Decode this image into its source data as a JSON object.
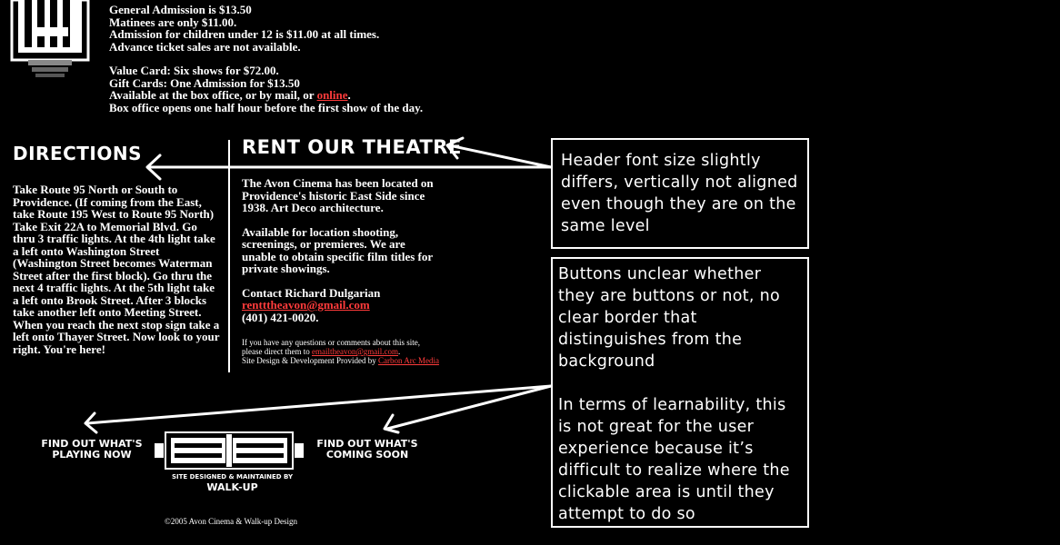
{
  "admission": {
    "lines": [
      "General Admission is $13.50",
      "Matinees are only $11.00.",
      "Admission for children under 12 is $11.00 at all times.",
      "Advance ticket sales are not available."
    ],
    "value_card": "Value Card: Six shows for $72.00.",
    "gift_cards": "Gift Cards: One Admission for $13.50",
    "available_prefix": "Available at the box office, or by mail, or ",
    "online_link": "online",
    "available_suffix": ".",
    "box_office": "Box office opens one half hour before the first show of the day."
  },
  "directions": {
    "heading": "Directions",
    "body": "Take Route 95 North or South to Providence. (If coming from the East, take Route 195 West to Route 95 North) Take Exit 22A to Memorial Blvd. Go thru 3 traffic lights. At the 4th light take a left onto Washington Street (Washington Street becomes Waterman Street after the first block). Go thru the next 4 traffic lights. At the 5th light take a left onto Brook Street. After 3 blocks take another left onto Meeting Street. When you reach the next stop sign take a left onto Thayer Street. Now look to your right. You're here!"
  },
  "rent": {
    "heading": "Rent Our Theatre",
    "p1": "The Avon Cinema has been located on Providence's historic East Side since 1938. Art Deco architecture.",
    "p2": "Available for location shooting, screenings, or premieres. We are unable to obtain specific film titles for private showings.",
    "contact": "Contact Richard Dulgarian",
    "email": "rentttheavon@gmail.com",
    "phone": "(401) 421-0020.",
    "small_1": "If you have any questions or comments about this site,",
    "small_2_prefix": "please direct them to ",
    "small_email": "emailtheavon@gmail.com",
    "small_2_suffix": ".",
    "small_3_prefix": "Site Design & Development Provided by ",
    "small_credit_link": "Carbon Arc Media"
  },
  "nav": {
    "playing_now_1": "Find out what's",
    "playing_now_2": "playing now",
    "coming_soon_1": "Find out what's",
    "coming_soon_2": "coming soon",
    "site_designed": "Site designed & maintained by",
    "walkup": "WALK-UP"
  },
  "footer": {
    "copyright": "©2005 Avon Cinema & Walk-up Design"
  },
  "annotations": {
    "note1": "Header font size slightly differs, vertically not aligned even though they are on the same level",
    "note2_p1": "Buttons unclear whether they are buttons or not, no clear border that distinguishes from the background",
    "note2_p2": "In terms of learnability, this is not great for the user experience because it’s difficult to realize where the clickable area is until they attempt to do so"
  },
  "colors": {
    "background": "#000000",
    "text": "#ffffff",
    "link": "#ff3b3b"
  }
}
